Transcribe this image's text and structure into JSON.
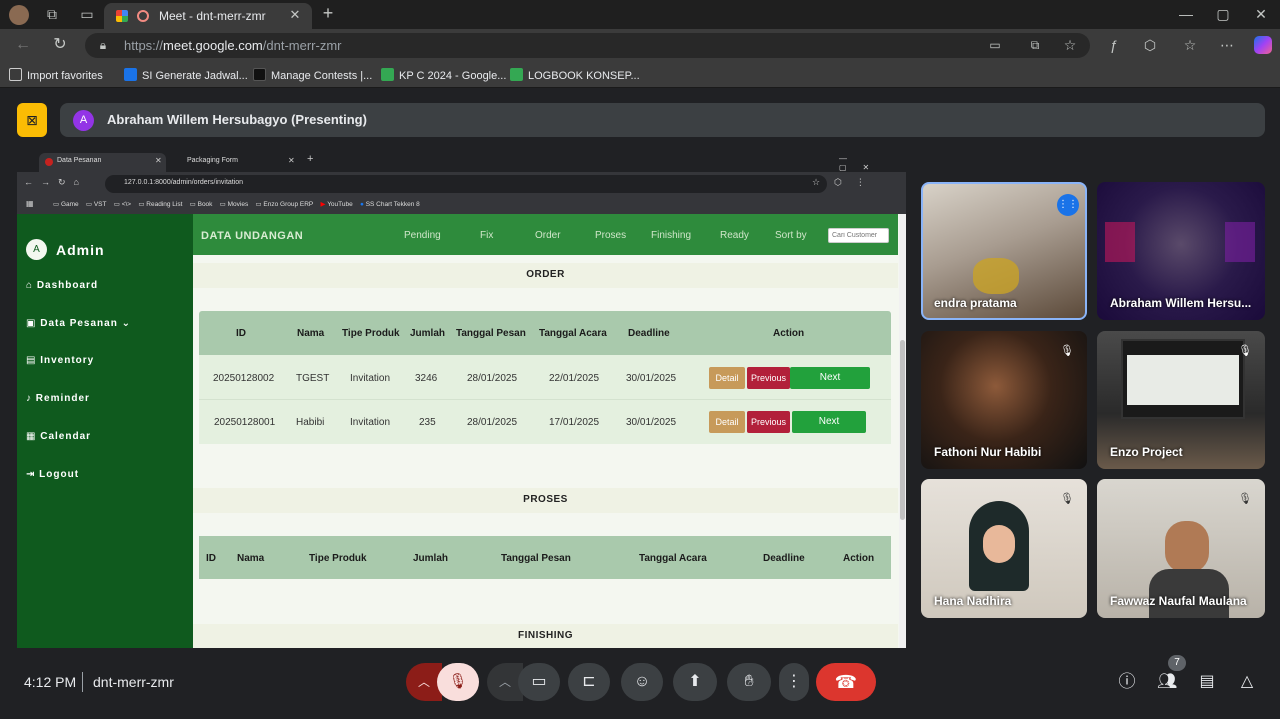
{
  "browser": {
    "tab_title": "Meet - dnt-merr-zmr",
    "url_prefix": "https://",
    "url_host": "meet.google.com",
    "url_path": "/dnt-merr-zmr",
    "bookmarks": [
      "Import favorites",
      "SI Generate Jadwal...",
      "Manage Contests |...",
      "KP C 2024 - Google...",
      "LOGBOOK KONSEP..."
    ]
  },
  "meet": {
    "presenter_initial": "A",
    "presenter_label": "Abraham Willem Hersubagyo (Presenting)",
    "time": "4:12 PM",
    "meeting_code": "dnt-merr-zmr",
    "people_count": "7",
    "participants": [
      {
        "name": "endra pratama"
      },
      {
        "name": "Abraham Willem Hersu..."
      },
      {
        "name": "Fathoni Nur Habibi"
      },
      {
        "name": "Enzo Project"
      },
      {
        "name": "Hana Nadhira"
      },
      {
        "name": "Fawwaz Naufal Maulana"
      }
    ]
  },
  "shared": {
    "tabs": [
      "Data Pesanan",
      "Packaging Form"
    ],
    "url": "127.0.0.1:8000/admin/orders/invitation",
    "bookmarks": [
      "Game",
      "VST",
      "<\\>",
      "Reading List",
      "Book",
      "Movies",
      "Enzo Group ERP",
      "YouTube",
      "SS Chart Tekken 8"
    ],
    "admin_initial": "A",
    "admin_title": "Admin",
    "sidebar": [
      "Dashboard",
      "Data Pesanan",
      "Inventory",
      "Reminder",
      "Calendar",
      "Logout"
    ],
    "page_title": "DATA UNDANGAN",
    "nav": [
      "Pending",
      "Fix",
      "Order",
      "Proses",
      "Finishing",
      "Ready",
      "Sort by"
    ],
    "search_placeholder": "Cari Customer",
    "order_section": "ORDER",
    "proses_section": "PROSES",
    "finishing_section": "FINISHING",
    "order_headers": [
      "ID",
      "Nama",
      "Tipe Produk",
      "Jumlah",
      "Tanggal Pesan",
      "Tanggal Acara",
      "Deadline",
      "Action"
    ],
    "order_rows": [
      [
        "20250128002",
        "TGEST",
        "Invitation",
        "3246",
        "28/01/2025",
        "22/01/2025",
        "30/01/2025"
      ],
      [
        "20250128001",
        "Habibi",
        "Invitation",
        "235",
        "28/01/2025",
        "17/01/2025",
        "30/01/2025"
      ]
    ],
    "btn_detail": "Detail",
    "btn_previous": "Previous",
    "btn_next": "Next",
    "proses_headers": [
      "ID",
      "Nama",
      "Tipe Produk",
      "Jumlah",
      "Tanggal Pesan",
      "Tanggal Acara",
      "Deadline",
      "Action"
    ]
  },
  "colors": {
    "accent_green": "#2e8b3c",
    "sidebar_green": "#0f5a1e",
    "end_call": "#ea4335",
    "present_yellow": "#fbbc04"
  }
}
